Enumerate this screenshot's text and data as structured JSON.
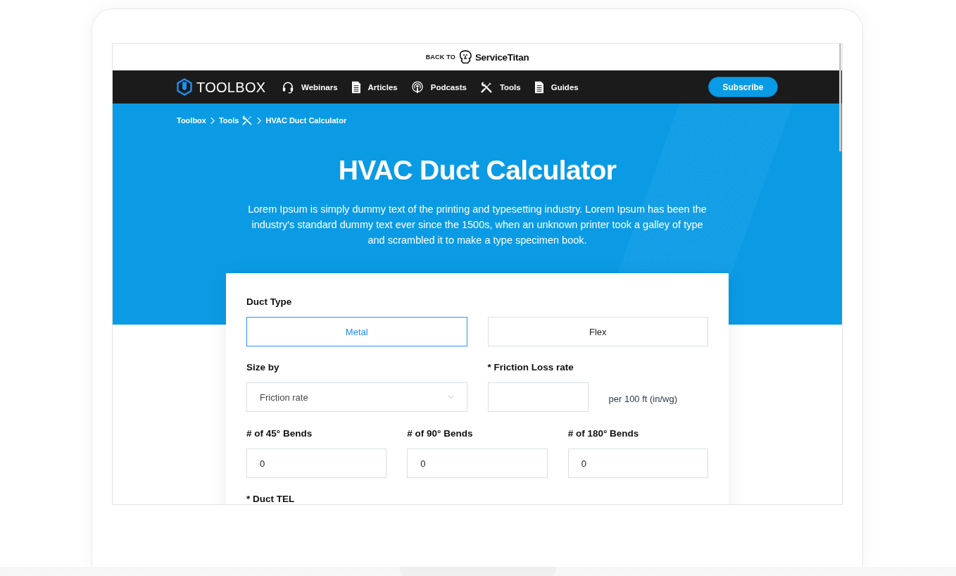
{
  "top_bar": {
    "back_to": "BACK TO",
    "brand": "ServiceTitan"
  },
  "nav": {
    "logo": "TOOLBOX",
    "items": [
      {
        "label": "Webinars",
        "kind": "webinars"
      },
      {
        "label": "Articles",
        "kind": "articles"
      },
      {
        "label": "Podcasts",
        "kind": "podcasts"
      },
      {
        "label": "Tools",
        "kind": "tools"
      },
      {
        "label": "Guides",
        "kind": "guides"
      }
    ],
    "subscribe": "Subscribe"
  },
  "breadcrumb": [
    {
      "label": "Toolbox",
      "kind": "link"
    },
    {
      "label": "Tools",
      "kind": "tools"
    },
    {
      "label": "HVAC Duct Calculator",
      "kind": "current"
    }
  ],
  "hero": {
    "title": "HVAC Duct Calculator",
    "description": "Lorem Ipsum is simply dummy text of the printing and typesetting industry. Lorem Ipsum has been the industry's standard dummy text ever since the 1500s, when an unknown printer took a galley of type and scrambled it to make a type specimen book."
  },
  "form": {
    "duct_type": {
      "label": "Duct Type",
      "options": [
        {
          "label": "Metal",
          "selected": true
        },
        {
          "label": "Flex",
          "selected": false
        }
      ]
    },
    "size_by": {
      "label": "Size by",
      "value": "Friction rate"
    },
    "friction_loss_rate": {
      "label": "* Friction Loss rate",
      "unit": "per 100 ft (in/wg)"
    },
    "bends": [
      {
        "label": "# of 45° Bends",
        "value": "0"
      },
      {
        "label": "# of 90° Bends",
        "value": "0"
      },
      {
        "label": "# of 180° Bends",
        "value": "0"
      }
    ],
    "duct_tel": {
      "label": "* Duct TEL"
    }
  }
}
